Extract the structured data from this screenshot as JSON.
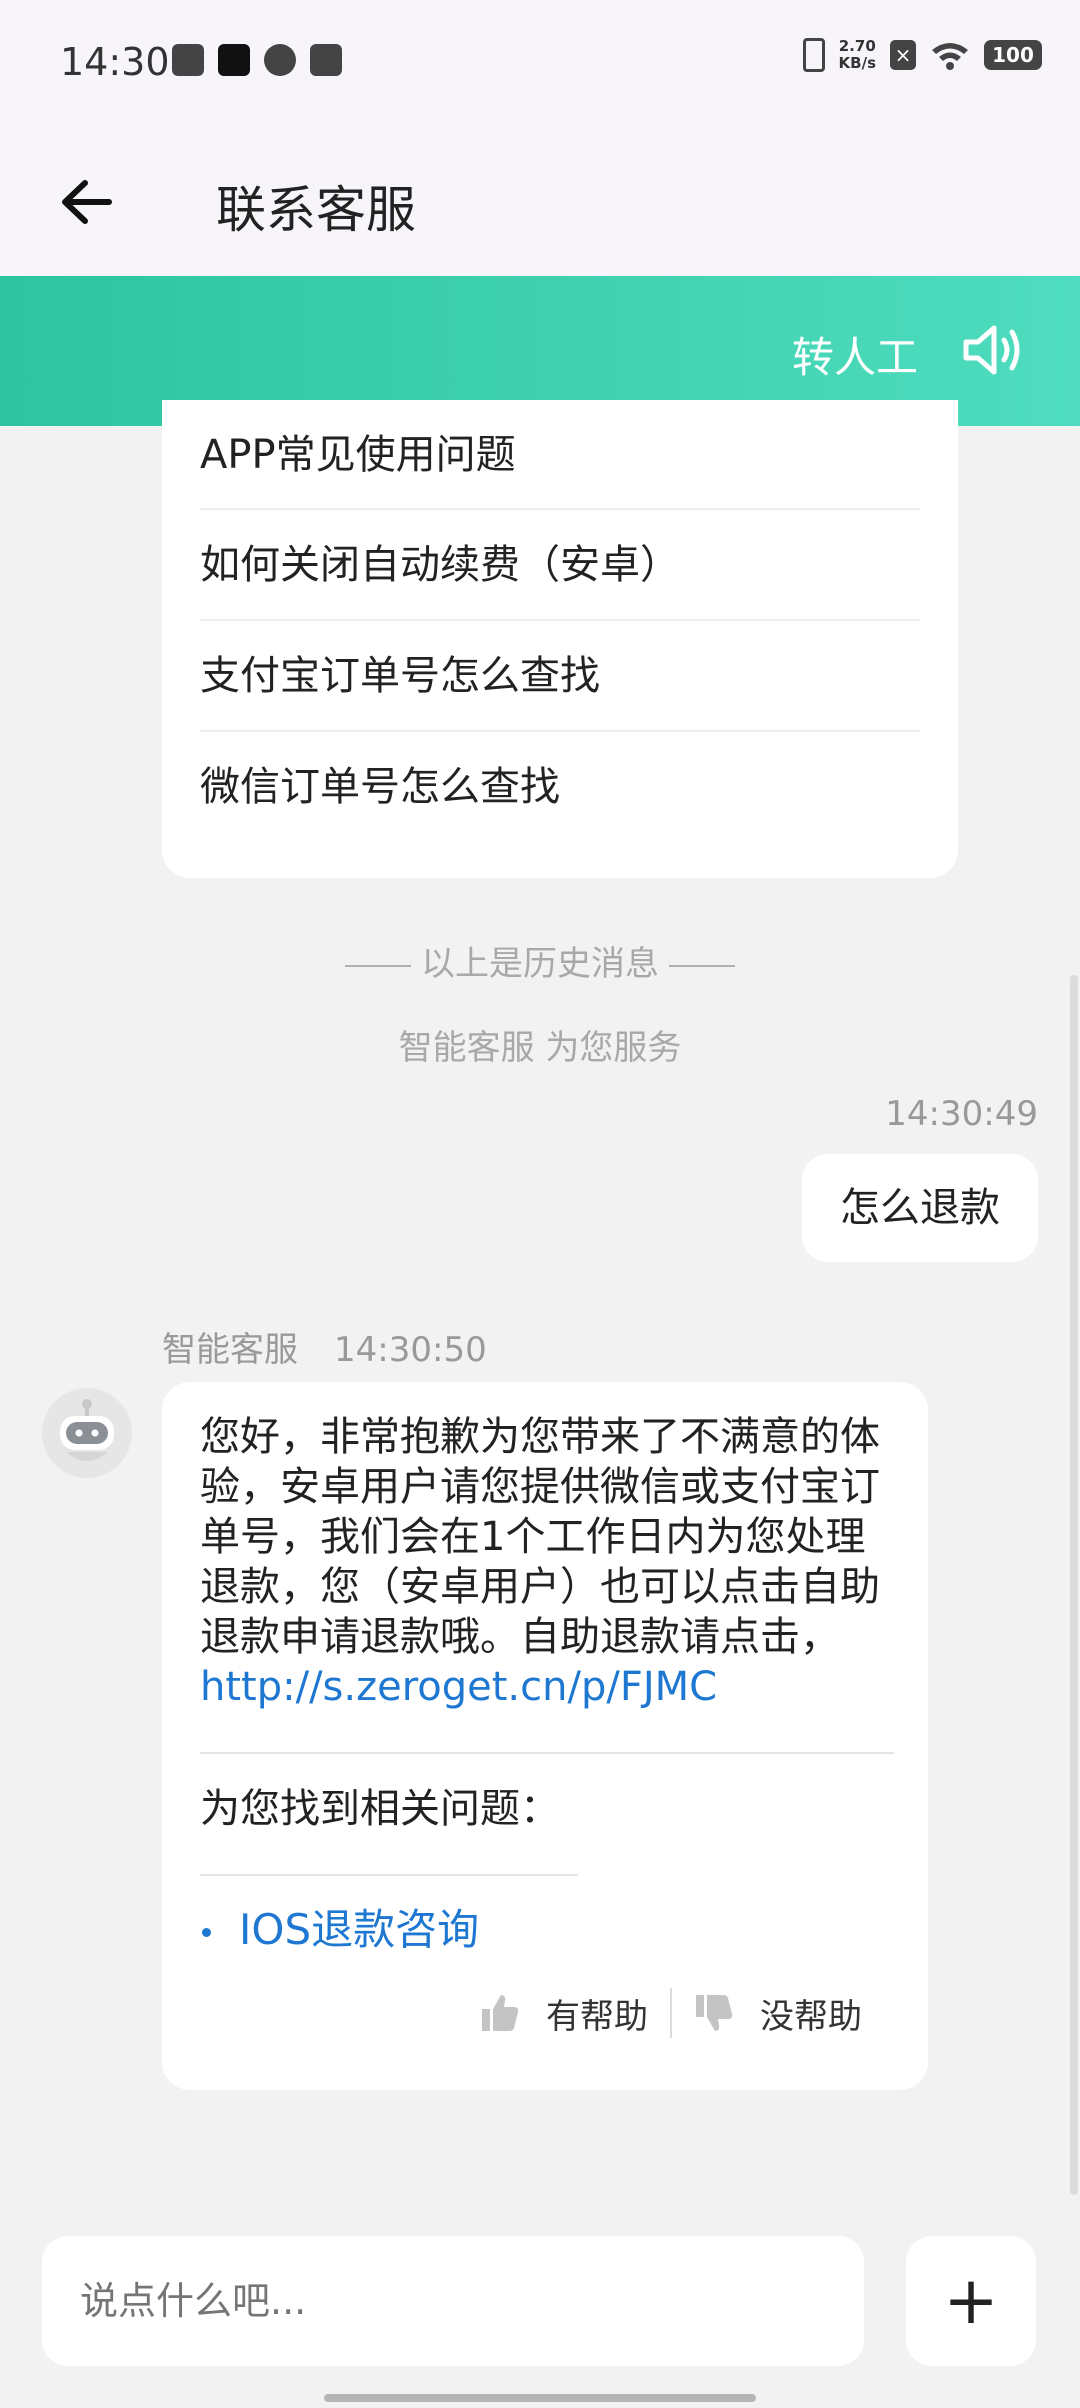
{
  "status_bar": {
    "time": "14:30",
    "net_speed_value": "2.70",
    "net_speed_unit": "KB/s",
    "battery": "100"
  },
  "header": {
    "title": "联系客服"
  },
  "action_bar": {
    "transfer_label": "转人工"
  },
  "faq": {
    "items": [
      "APP常见使用问题",
      "如何关闭自动续费（安卓）",
      "支付宝订单号怎么查找",
      "微信订单号怎么查找"
    ]
  },
  "chat": {
    "history_divider": "以上是历史消息",
    "service_note": "智能客服 为您服务",
    "user_message": {
      "time": "14:30:49",
      "text": "怎么退款"
    },
    "bot_message": {
      "sender": "智能客服",
      "time": "14:30:50",
      "text": "您好，非常抱歉为您带来了不满意的体验，安卓用户请您提供微信或支付宝订单号，我们会在1个工作日内为您处理退款，您（安卓用户）也可以点击自助退款申请退款哦。自助退款请点击，",
      "link": "http://s.zeroget.cn/p/FJMC",
      "related_title": "为您找到相关问题：",
      "related_item": "IOS退款咨询",
      "helpful_label": "有帮助",
      "unhelpful_label": "没帮助"
    }
  },
  "input": {
    "placeholder": "说点什么吧..."
  },
  "colors": {
    "accent_green": "#2ec4a0",
    "link_blue": "#1e78d2"
  }
}
